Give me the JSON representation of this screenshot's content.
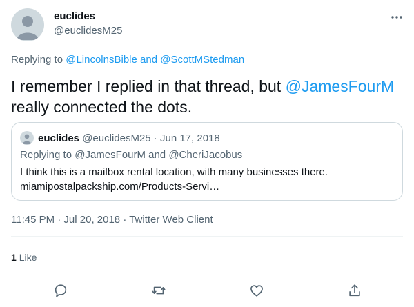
{
  "author": {
    "display_name": "euclides",
    "handle": "@euclidesM25"
  },
  "reply_context": {
    "prefix": "Replying to",
    "mention_1": "@LincolnsBible",
    "joiner": "and",
    "mention_2": "@ScottMStedman"
  },
  "tweet": {
    "text_before": "I remember I replied in that thread, but",
    "mention": "@JamesFourM",
    "text_after": "really connected the dots."
  },
  "quoted_tweet": {
    "display_name": "euclides",
    "meta": "@euclidesM25 · Jun 17, 2018",
    "replying": "Replying to @JamesFourM and @CheriJacobus",
    "line_1": "I think this is a mailbox rental location, with many businesses there.",
    "line_2": "miamipostalpackship.com/Products-Servi…"
  },
  "meta": {
    "timestamp": "11:45 PM · Jul 20, 2018 · Twitter Web Client"
  },
  "stats": {
    "like_count": "1",
    "like_label": "Like"
  },
  "icons": {
    "more": "more-icon",
    "reply": "reply-icon",
    "retweet": "retweet-icon",
    "like": "like-icon",
    "share": "share-icon"
  },
  "colors": {
    "accent": "#1d9bf0",
    "text": "#0f1419",
    "secondary": "#536471",
    "border": "#cfd9de"
  }
}
